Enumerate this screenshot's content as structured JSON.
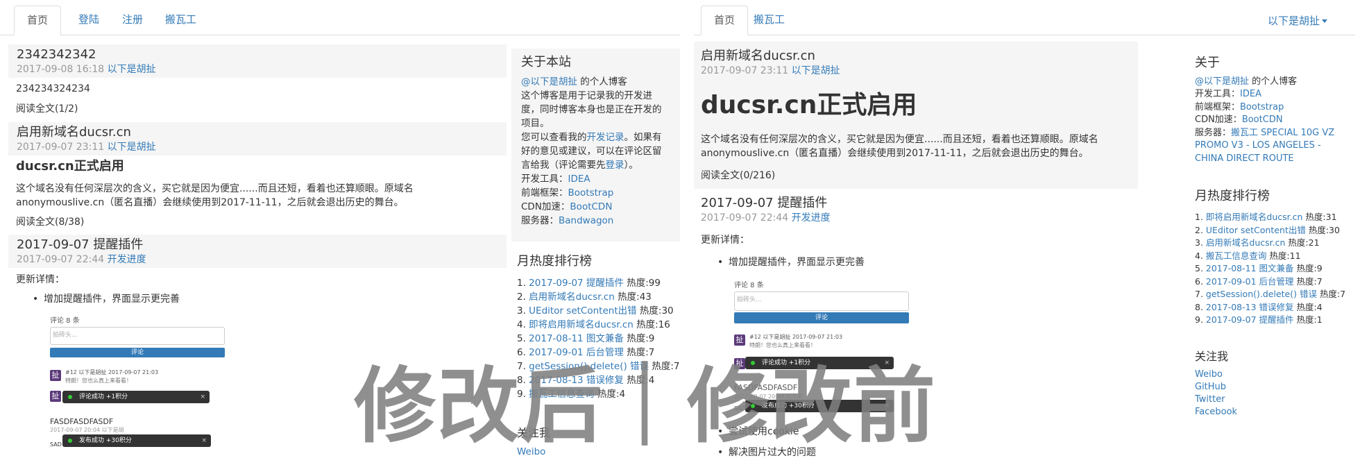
{
  "left": {
    "tabs": [
      "首页",
      "登陆",
      "注册",
      "搬瓦工"
    ],
    "posts": [
      {
        "title": "2342342342",
        "date": "2017-09-08 16:18",
        "author": "以下是胡扯",
        "body": "234234324234",
        "read_more": "阅读全文(1/2)"
      },
      {
        "title": "启用新域名ducsr.cn",
        "date": "2017-09-07 23:11",
        "author": "以下是胡扯",
        "heading": "ducsr.cn正式启用",
        "body1": "这个域名没有任何深层次的含义，买它就是因为便宜......而且还短，看着也还算顺眼。原域名",
        "body2": "anonymouslive.cn（匿名直播）会继续使用到2017-11-11，之后就会退出历史的舞台。",
        "read_more": "阅读全文(8/38)"
      },
      {
        "title": "2017-09-07 提醒插件",
        "date": "2017-09-07 22:44",
        "author": "开发进度",
        "detail_label": "更新详情：",
        "bullet": "增加提醒插件，界面显示更完善"
      }
    ],
    "about": {
      "heading": "关于本站",
      "owner_link": "@以下是胡扯",
      "owner_suffix": " 的个人博客",
      "desc1": "这个博客是用于记录我的开发进",
      "desc2": "度，同时博客本身也是正在开发的",
      "desc3": "项目。",
      "desc4_pre": "您可以查看我的",
      "desc4_link": "开发记录",
      "desc4_post": "。如果有",
      "desc5": "好的意见或建议，可以在评论区留",
      "desc6_pre": "言给我（评论需要先",
      "desc6_link": "登录",
      "desc6_post": "）。",
      "tools": [
        {
          "label": "开发工具：",
          "value": "IDEA"
        },
        {
          "label": "前端框架：",
          "value": "Bootstrap"
        },
        {
          "label": "CDN加速：",
          "value": "BootCDN"
        },
        {
          "label": "服务器：",
          "value": "Bandwagon"
        }
      ]
    },
    "ranking": {
      "heading": "月热度排行榜",
      "items": [
        {
          "title": "2017-09-07 提醒插件",
          "heat": "热度:99"
        },
        {
          "title": "启用新域名ducsr.cn",
          "heat": "热度:43"
        },
        {
          "title": "UEditor setContent出错",
          "heat": "热度:30"
        },
        {
          "title": "即将启用新域名ducsr.cn",
          "heat": "热度:16"
        },
        {
          "title": "2017-08-11 图文兼备",
          "heat": "热度:9"
        },
        {
          "title": "2017-09-01 后台管理",
          "heat": "热度:7"
        },
        {
          "title": "getSession().delete() 错误",
          "heat": "热度:7"
        },
        {
          "title": "2017-08-13 错误修复",
          "heat": "热度:4"
        },
        {
          "title": "搬瓦工信息查询",
          "heat": "热度:4"
        }
      ]
    },
    "follow": {
      "heading": "关注我",
      "first": "Weibo"
    },
    "comments": {
      "count": "评论 8 条",
      "placeholder": "拍砖头...",
      "submit": "评论",
      "avatar": "扯",
      "c1_meta": "#12 以下是胡扯 2017-09-07 21:03",
      "c1_text": "特朗！您也么真上来看看！",
      "toast1": "评论成功 +1积分",
      "name2": "FASDFASDFASDF",
      "meta2": "2017-09-07 20:04 以下是胡",
      "toast2": "发布成功 +30积分",
      "tail": "SAD"
    }
  },
  "right": {
    "tabs": [
      "首页",
      "搬瓦工"
    ],
    "user_menu": "以下是胡扯",
    "posts": [
      {
        "title": "启用新域名ducsr.cn",
        "date": "2017-09-07 23:11",
        "author": "以下是胡扯",
        "heading": "ducsr.cn正式启用",
        "body1": "这个域名没有任何深层次的含义，买它就是因为便宜......而且还短，看着也还算顺眼。原域名",
        "body2": "anonymouslive.cn（匿名直播）会继续使用到2017-11-11，之后就会退出历史的舞台。",
        "read_more": "阅读全文(0/216)"
      },
      {
        "title": "2017-09-07 提醒插件",
        "date": "2017-09-07 22:44",
        "author": "开发进度",
        "detail_label": "更新详情：",
        "bullets": [
          "增加提醒插件，界面显示更完善",
          "尝试使用cookie",
          "解决图片过大的问题"
        ]
      }
    ],
    "about": {
      "heading": "关于",
      "owner_link": "@以下是胡扯",
      "owner_suffix": " 的个人博客",
      "tools": [
        {
          "label": "开发工具：",
          "value": "IDEA"
        },
        {
          "label": "前端框架：",
          "value": "Bootstrap"
        },
        {
          "label": "CDN加速：",
          "value": "BootCDN"
        }
      ],
      "server_label": "服务器：",
      "server_value1": "搬瓦工 SPECIAL 10G VZ",
      "server_value2": "PROMO V3 - LOS ANGELES -",
      "server_value3": "CHINA DIRECT ROUTE"
    },
    "ranking": {
      "heading": "月热度排行榜",
      "items": [
        {
          "title": "即将启用新域名ducsr.cn",
          "heat": "热度:31"
        },
        {
          "title": "UEditor setContent出错",
          "heat": "热度:30"
        },
        {
          "title": "启用新域名ducsr.cn",
          "heat": "热度:21"
        },
        {
          "title": "搬瓦工信息查询",
          "heat": "热度:11"
        },
        {
          "title": "2017-08-11 图文兼备",
          "heat": "热度:9"
        },
        {
          "title": "2017-09-01 后台管理",
          "heat": "热度:7"
        },
        {
          "title": "getSession().delete() 错误",
          "heat": "热度:7"
        },
        {
          "title": "2017-08-13 错误修复",
          "heat": "热度:4"
        },
        {
          "title": "2017-09-07 提醒插件",
          "heat": "热度:1"
        }
      ]
    },
    "follow": {
      "heading": "关注我",
      "links": [
        "Weibo",
        "GitHub",
        "Twitter",
        "Facebook"
      ]
    },
    "comments": {
      "count": "评论 8 条",
      "placeholder": "拍砖头...",
      "submit": "评论",
      "avatar": "扯",
      "c1_meta": "#12 以下是胡扯 2017-09-07 21:03",
      "c1_text": "特朗！您也么真上来看看！",
      "toast1": "评论成功 +1积分",
      "name2": "FASDFASDFASDF",
      "meta2": "2017-09-07 20:04 以下是",
      "toast2": "发布成功 +30积分",
      "tail": "SAD"
    }
  },
  "watermark": "修改后｜修改前"
}
